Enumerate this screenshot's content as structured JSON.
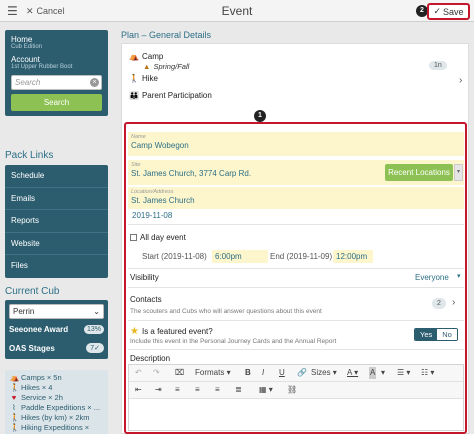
{
  "topbar": {
    "menu_icon": "hamburger-icon",
    "cancel_label": "Cancel",
    "title": "Event",
    "callout_2": "2",
    "save_label": "Save"
  },
  "sidebar": {
    "home_label": "Home",
    "home_sub": "Cub Edition",
    "account_label": "Account",
    "account_sub": "1st Upper Rubber Boot",
    "search_placeholder": "Search",
    "search_button": "Search"
  },
  "pack_links": {
    "heading": "Pack Links",
    "items": [
      "Schedule",
      "Emails",
      "Reports",
      "Website",
      "Files"
    ]
  },
  "current_cub": {
    "heading": "Current Cub",
    "selected": "Perrin",
    "seeonee_label": "Seeonee Award",
    "seeonee_pct": "13%",
    "oas_label": "OAS Stages",
    "oas_badge": "7",
    "oas_items": [
      {
        "icon": "camp-icon",
        "text": "Camps × 5n",
        "color": "#2c5d6f"
      },
      {
        "icon": "hike-icon",
        "text": "Hikes × 4",
        "color": "#2c5d6f"
      },
      {
        "icon": "heart-icon",
        "text": "Service × 2h",
        "color": "#c4172c"
      },
      {
        "icon": "paddle-icon",
        "text": "Paddle Expeditions × ...",
        "color": "#2c5d6f"
      },
      {
        "icon": "hike-icon",
        "text": "Hikes (by km) × 2km",
        "color": "#2c5d6f"
      },
      {
        "icon": "hike-icon",
        "text": "Hiking Expeditions ×",
        "color": "#2c5d6f"
      }
    ]
  },
  "main": {
    "plan_title": "Plan – General Details",
    "event_types": [
      {
        "icon": "camp-icon",
        "label": "Camp",
        "sub": "Spring/Fall",
        "sub_icon": "tent-icon"
      },
      {
        "icon": "hike-icon",
        "label": "Hike"
      },
      {
        "icon": "parent-icon",
        "label": "Parent Participation"
      }
    ],
    "type_pill": "1n",
    "callout_1": "1",
    "name": {
      "label": "Name",
      "value": "Camp Wobegon"
    },
    "site": {
      "label": "Site",
      "value": "St. James Church, 3774 Carp Rd."
    },
    "recent_locations": "Recent Locations",
    "location": {
      "label": "Location/Address",
      "value": "St. James Church"
    },
    "date": "2019-11-08",
    "all_day_label": "All day event",
    "start_label": "Start (2019-11-08)",
    "start_time": "6:00pm",
    "end_label": "End (2019-11-09)",
    "end_time": "12:00pm",
    "visibility_label": "Visibility",
    "visibility_value": "Everyone",
    "contacts_label": "Contacts",
    "contacts_sub": "The scouters and Cubs who will answer questions about this event",
    "contacts_count": "2",
    "featured_label": "Is a featured event?",
    "featured_sub": "Include this event in the Personal Journey Cards and the Annual Report",
    "yes_label": "Yes",
    "no_label": "No",
    "description_label": "Description",
    "toolbar": {
      "formats": "Formats",
      "sizes": "Sizes",
      "bold": "B",
      "italic": "I"
    }
  },
  "colors": {
    "accent_teal": "#2c5d6f",
    "green": "#8dc153",
    "highlight_red": "#c4172c",
    "field_yellow": "#fdf6cc"
  }
}
